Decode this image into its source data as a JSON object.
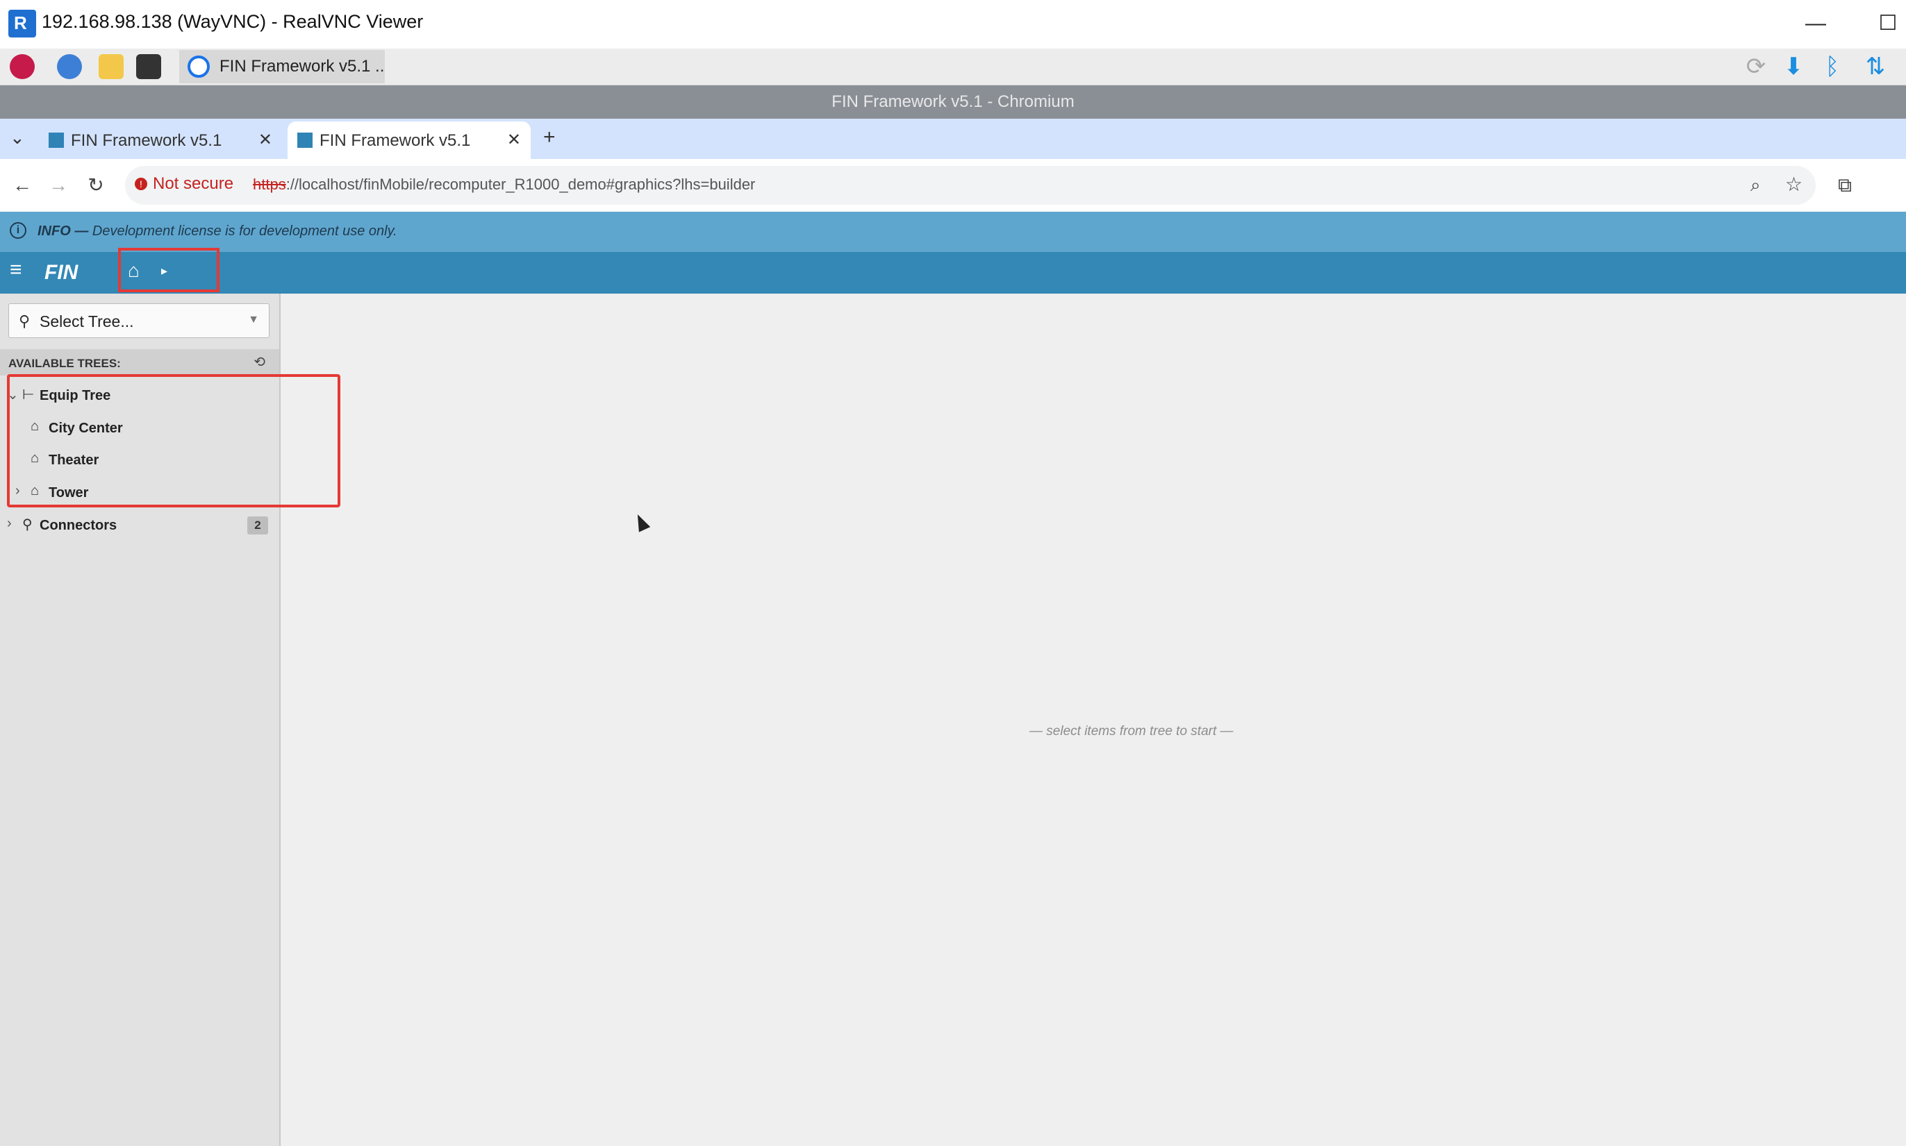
{
  "window": {
    "title": "192.168.98.138 (WayVNC) - RealVNC Viewer",
    "app_icon_letter": "R",
    "minimize_glyph": "—",
    "maximize_glyph": "☐"
  },
  "taskbar": {
    "icons": [
      "raspberry-icon",
      "globe-icon",
      "folder-icon",
      "terminal-icon"
    ],
    "task_label": "FIN Framework v5.1 ..",
    "tray_icons": [
      "sync-icon",
      "download-icon",
      "bluetooth-icon",
      "network-icon"
    ]
  },
  "browser": {
    "window_title": "FIN Framework v5.1 - Chromium",
    "tab_list_glyph": "⌄",
    "tabs": [
      {
        "label": "FIN Framework v5.1",
        "active": false
      },
      {
        "label": "FIN Framework v5.1",
        "active": true
      }
    ],
    "new_tab_glyph": "+",
    "close_glyph": "✕",
    "security_label": "Not secure",
    "url_scheme": "https",
    "url_rest": "://localhost/finMobile/recomputer_R1000_demo#graphics?lhs=builder"
  },
  "info_banner": {
    "label": "INFO —",
    "message": "Development license is for development use only."
  },
  "app": {
    "logo_text": "FIN",
    "select_tree_label": "Select Tree...",
    "available_trees_heading": "AVAILABLE TREES:",
    "tree": [
      {
        "label": "Equip Tree",
        "expanded": true,
        "level": 0,
        "icon": "equip-tree-icon"
      },
      {
        "label": "City Center",
        "level": 1,
        "icon": "building-icon"
      },
      {
        "label": "Theater",
        "level": 1,
        "icon": "building-icon"
      },
      {
        "label": "Tower",
        "level": 1,
        "icon": "building-icon",
        "expandable": true
      },
      {
        "label": "Connectors",
        "level": 0,
        "icon": "connectors-icon",
        "expandable": true,
        "badge": "2"
      }
    ],
    "empty_state": "— select items from tree to start —"
  },
  "colors": {
    "accent": "#3388b6",
    "banner": "#5fa6cf",
    "highlight": "#e53935"
  }
}
